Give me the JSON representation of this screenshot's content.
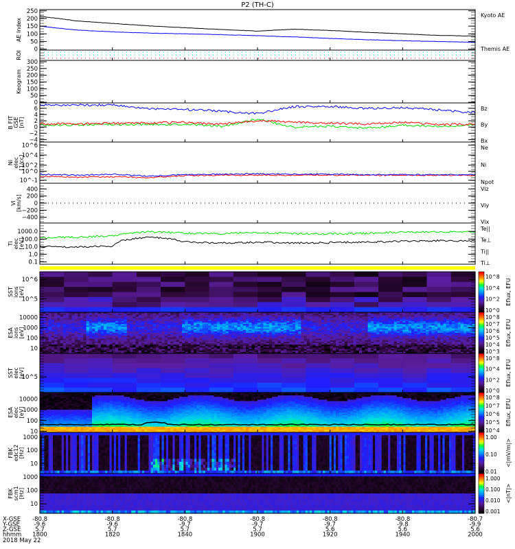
{
  "title": "P2 (TH-C)",
  "colors": {
    "black": "#000000",
    "blue": "#0000ff",
    "red": "#ff0000",
    "green": "#00dd00",
    "cyan": "#00e0c0",
    "yellow": "#ffff00"
  },
  "panels": [
    {
      "id": "ae",
      "ylabel": [
        "AE Index"
      ],
      "scale": "lin",
      "range": [
        -6,
        258
      ],
      "ticks": [
        {
          "v": 250,
          "l": "250"
        },
        {
          "v": 200,
          "l": "200"
        },
        {
          "v": 150,
          "l": "150"
        },
        {
          "v": 100,
          "l": "100"
        },
        {
          "v": 50,
          "l": "50"
        },
        {
          "v": 0,
          "l": "0"
        }
      ],
      "legend": [
        {
          "label": "Kyoto AE",
          "color": "#0000ff"
        },
        {
          "label": "Themis AE",
          "color": "#000000"
        }
      ]
    },
    {
      "id": "roi",
      "ylabel": [
        "ROI"
      ],
      "scale": "lin",
      "range": [
        0,
        1
      ],
      "ticks": [],
      "legend": []
    },
    {
      "id": "keo",
      "ylabel": [
        "Keogram"
      ],
      "scale": "lin",
      "range": [
        -5,
        310
      ],
      "ticks": [
        {
          "v": 300,
          "l": "300"
        },
        {
          "v": 250,
          "l": "250"
        },
        {
          "v": 200,
          "l": "200"
        },
        {
          "v": 150,
          "l": "150"
        },
        {
          "v": 100,
          "l": "100"
        },
        {
          "v": 50,
          "l": "50"
        },
        {
          "v": 0,
          "l": "0"
        }
      ],
      "legend": []
    },
    {
      "id": "b",
      "ylabel": [
        "B FIT",
        "GSE",
        "[nT]"
      ],
      "scale": "lin",
      "range": [
        -4.8,
        7.7
      ],
      "ticks": [
        {
          "v": 6,
          "l": "6"
        },
        {
          "v": 4,
          "l": "4"
        },
        {
          "v": 2,
          "l": "2"
        },
        {
          "v": 0,
          "l": "0"
        },
        {
          "v": -2,
          "l": "−2"
        },
        {
          "v": -4,
          "l": "−4"
        }
      ],
      "legend": [
        {
          "label": "Bz",
          "color": "#ff0000"
        },
        {
          "label": "By",
          "color": "#00dd00"
        },
        {
          "label": "Bx",
          "color": "#0000ff"
        }
      ]
    },
    {
      "id": "ni",
      "ylabel": [
        "Ni",
        "elec",
        "[1/cc]"
      ],
      "scale": "lin",
      "range": [
        -1.6,
        6.6
      ],
      "ticks": [
        {
          "v": 6,
          "l": "10^6"
        },
        {
          "v": 4,
          "l": "10^4"
        },
        {
          "v": 2,
          "l": "10^2"
        },
        {
          "v": 0.8,
          "l": "10^0"
        },
        {
          "v": -1,
          "l": "10^-1"
        }
      ],
      "legend": [
        {
          "label": "Ne",
          "color": "#ff0000"
        },
        {
          "label": "Ni",
          "color": "#000000"
        },
        {
          "label": "Npot",
          "color": "#0000ff"
        }
      ]
    },
    {
      "id": "vi",
      "ylabel": [
        "Vi",
        "[km/s]"
      ],
      "scale": "lin",
      "range": [
        -560,
        560
      ],
      "ticks": [
        {
          "v": 400,
          "l": "400"
        },
        {
          "v": 200,
          "l": "200"
        },
        {
          "v": 0,
          "l": "0"
        },
        {
          "v": -200,
          "l": "−200"
        },
        {
          "v": -400,
          "l": "−400"
        }
      ],
      "legend": [
        {
          "label": "Viz",
          "color": "#ff0000"
        },
        {
          "label": "Viy",
          "color": "#00dd00"
        },
        {
          "label": "Vix",
          "color": "#0000ff"
        }
      ]
    },
    {
      "id": "ti",
      "ylabel": [
        "Ti",
        "elec",
        "[eV]"
      ],
      "scale": "log",
      "range": [
        -1.3,
        4.1
      ],
      "ticks": [
        {
          "v": 1000,
          "l": "1000.0"
        },
        {
          "v": 100,
          "l": "100.0"
        },
        {
          "v": 10,
          "l": "10.0"
        },
        {
          "v": 1,
          "l": "1.0"
        },
        {
          "v": 0.1,
          "l": "0.1"
        }
      ],
      "legend": [
        {
          "label": "Te||",
          "color": "#000000"
        },
        {
          "label": "Te⊥",
          "color": "#ff0000"
        },
        {
          "label": "Ti||",
          "color": "#00dd00"
        },
        {
          "label": "Ti⊥",
          "color": "#0000ff"
        }
      ]
    },
    {
      "id": "ssti",
      "ylabel": [
        "SST",
        "ions",
        "[eV]"
      ],
      "scale": "lin",
      "range": [
        4.3,
        6.4
      ],
      "ticks": [
        {
          "v": 6,
          "l": "10^6"
        },
        {
          "v": 5,
          "l": "10^5"
        }
      ],
      "legend": []
    },
    {
      "id": "esai",
      "ylabel": [
        "ESA",
        "ions",
        "[eV]"
      ],
      "scale": "lin",
      "range": [
        0.5,
        4.5
      ],
      "ticks": [
        {
          "v": 4,
          "l": "10000"
        },
        {
          "v": 3,
          "l": "1000"
        },
        {
          "v": 2,
          "l": "100"
        },
        {
          "v": 1,
          "l": "10"
        }
      ],
      "legend": []
    },
    {
      "id": "sste",
      "ylabel": [
        "SST",
        "elec",
        "[eV]"
      ],
      "scale": "lin",
      "range": [
        4.2,
        6.2
      ],
      "ticks": [
        {
          "v": 5,
          "l": "10^5"
        }
      ],
      "legend": []
    },
    {
      "id": "esae",
      "ylabel": [
        "ESA",
        "elec",
        "[eV]"
      ],
      "scale": "lin",
      "range": [
        0.9,
        4.6
      ],
      "ticks": [
        {
          "v": 4,
          "l": "10000"
        },
        {
          "v": 3,
          "l": "1000"
        },
        {
          "v": 2,
          "l": "100"
        },
        {
          "v": 1,
          "l": "10"
        }
      ],
      "legend": []
    },
    {
      "id": "fbk1",
      "ylabel": [
        "FBK",
        "edc12",
        "[Hz]"
      ],
      "scale": "lin",
      "range": [
        0.25,
        3.35
      ],
      "ticks": [
        {
          "v": 3,
          "l": "1000"
        },
        {
          "v": 2,
          "l": "100"
        },
        {
          "v": 1,
          "l": "10"
        }
      ],
      "legend": []
    },
    {
      "id": "fbk2",
      "ylabel": [
        "FBK",
        "scm1",
        "[Hz]"
      ],
      "scale": "lin",
      "range": [
        0.3,
        3.25
      ],
      "ticks": [
        {
          "v": 3,
          "l": "1000"
        },
        {
          "v": 2,
          "l": "100"
        },
        {
          "v": 1,
          "l": "10"
        }
      ],
      "legend": []
    }
  ],
  "colorbars": [
    {
      "panel": "ssti",
      "title": "Eflux, EFU",
      "labels": [
        "10^8",
        "10^4",
        "10^2",
        "10^0"
      ]
    },
    {
      "panel": "esai",
      "title": "Eflux, EFU",
      "labels": [
        "10^8",
        "10^7",
        "10^6",
        "10^5",
        "10^4",
        "10^3"
      ]
    },
    {
      "panel": "sste",
      "title": "Eflux, EFU",
      "labels": [
        "10^8",
        "10^4",
        "10^2",
        "10^0"
      ]
    },
    {
      "panel": "esae",
      "title": "Eflux, EFU",
      "labels": [
        "10^8",
        "10^7",
        "10^6",
        "10^5",
        "10^4"
      ]
    },
    {
      "panel": "fbk1",
      "title": "<|mV/m|>",
      "labels": [
        "1.00",
        "0.10",
        "0.01"
      ]
    },
    {
      "panel": "fbk2",
      "title": "<|nT|>",
      "labels": [
        "1.000",
        "0.100",
        "0.010",
        "0.001"
      ]
    }
  ],
  "ephemeris": {
    "row_labels": [
      "X-GSE",
      "Y-GSE",
      "Z-GSE",
      "hhmm"
    ],
    "columns": [
      [
        "-80.8",
        "-9.6",
        "5.7",
        "1800"
      ],
      [
        "-80.8",
        "-9.6",
        "5.7",
        "1820"
      ],
      [
        "-80.8",
        "-9.7",
        "5.7",
        "1840"
      ],
      [
        "-80.8",
        "-9.7",
        "5.7",
        "1900"
      ],
      [
        "-80.8",
        "-9.7",
        "5.6",
        "1920"
      ],
      [
        "-80.8",
        "-9.8",
        "5.6",
        "1940"
      ],
      [
        "-80.7",
        "-9.9",
        "5.6",
        "2000"
      ]
    ],
    "date": "2018 May 22"
  },
  "chart_data": {
    "type": "line",
    "x_label": "hhmm",
    "x": [
      1800,
      1810,
      1820,
      1830,
      1840,
      1850,
      1900,
      1910,
      1920,
      1930,
      1940,
      1950,
      2000
    ],
    "series": [
      {
        "panel": "ae",
        "name": "Themis AE",
        "values": [
          215,
          185,
          168,
          152,
          140,
          128,
          118,
          130,
          122,
          110,
          100,
          90,
          85
        ]
      },
      {
        "panel": "ae",
        "name": "Kyoto AE",
        "values": [
          150,
          125,
          113,
          105,
          100,
          95,
          88,
          80,
          70,
          62,
          55,
          50,
          45
        ]
      },
      {
        "panel": "b",
        "name": "Bz",
        "values": [
          7.0,
          7.0,
          7.1,
          5.8,
          5.6,
          5.0,
          4.3,
          6.5,
          6.6,
          5.9,
          6.2,
          5.5,
          4.6
        ]
      },
      {
        "panel": "b",
        "name": "By",
        "values": [
          0.6,
          0.7,
          0.9,
          0.8,
          1.0,
          0.2,
          2.5,
          0.0,
          0.3,
          -0.4,
          0.6,
          0.2,
          0.8
        ]
      },
      {
        "panel": "b",
        "name": "Bx",
        "values": [
          1.0,
          1.0,
          1.2,
          1.3,
          1.5,
          0.9,
          2.0,
          1.6,
          1.2,
          1.0,
          1.5,
          0.8,
          0.9
        ]
      },
      {
        "panel": "ni",
        "name": "Ne",
        "values": [
          -0.2,
          -0.4,
          -0.3,
          -0.5,
          -0.1,
          0.0,
          0.0,
          0.0,
          0.0,
          0.0,
          0.0,
          0.0,
          0.0
        ]
      },
      {
        "panel": "ni",
        "name": "Npot",
        "values": [
          0.2,
          0.0,
          0.2,
          -0.2,
          0.1,
          0.2,
          0.3,
          0.2,
          0.2,
          0.1,
          0.1,
          0.1,
          0.1
        ]
      },
      {
        "panel": "ti",
        "name": "Ti||",
        "values": [
          150,
          180,
          250,
          900,
          600,
          500,
          700,
          500,
          500,
          550,
          800,
          900,
          800
        ]
      },
      {
        "panel": "ti",
        "name": "Te||",
        "values": [
          10,
          9,
          12,
          180,
          40,
          30,
          40,
          30,
          35,
          40,
          50,
          60,
          55
        ]
      }
    ]
  }
}
